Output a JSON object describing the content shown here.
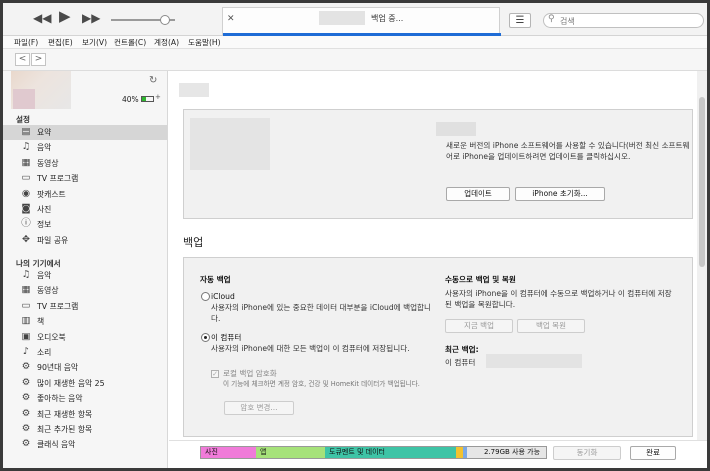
{
  "player": {
    "prev_icon": "rewind-icon",
    "play_icon": "play-icon",
    "next_icon": "fast-forward-icon",
    "volume_level": 0.85
  },
  "lcd": {
    "status": "백업 중...",
    "close_icon": "close-icon"
  },
  "search": {
    "placeholder": "검색"
  },
  "menu": [
    "파일(F)",
    "편집(E)",
    "보기(V)",
    "컨트롤(C)",
    "계정(A)",
    "도움말(H)"
  ],
  "nav": {
    "back": "<",
    "forward": ">"
  },
  "device": {
    "battery": "40%",
    "battery_level": 0.4
  },
  "sidebar": {
    "settings_title": "설정",
    "settings_items": [
      {
        "label": "요약",
        "icon": "summary-icon",
        "glyph": "▤",
        "selected": true
      },
      {
        "label": "음악",
        "icon": "music-note-icon",
        "glyph": "♫"
      },
      {
        "label": "동영상",
        "icon": "film-icon",
        "glyph": "▦"
      },
      {
        "label": "TV 프로그램",
        "icon": "tv-icon",
        "glyph": "▭"
      },
      {
        "label": "팟캐스트",
        "icon": "podcast-icon",
        "glyph": "◉"
      },
      {
        "label": "사진",
        "icon": "camera-icon",
        "glyph": "◙"
      },
      {
        "label": "정보",
        "icon": "info-icon",
        "glyph": "ⓘ"
      },
      {
        "label": "파일 공유",
        "icon": "file-sharing-icon",
        "glyph": "✥"
      }
    ],
    "device_title": "나의 기기에서",
    "device_items": [
      {
        "label": "음악",
        "icon": "music-note-icon",
        "glyph": "♫"
      },
      {
        "label": "동영상",
        "icon": "film-icon",
        "glyph": "▦"
      },
      {
        "label": "TV 프로그램",
        "icon": "tv-icon",
        "glyph": "▭"
      },
      {
        "label": "책",
        "icon": "book-icon",
        "glyph": "▥"
      },
      {
        "label": "오디오북",
        "icon": "audiobook-icon",
        "glyph": "▣"
      },
      {
        "label": "소리",
        "icon": "bell-icon",
        "glyph": "♪"
      },
      {
        "label": "90년대 음악",
        "icon": "smart-playlist-gear-icon",
        "glyph": "⚙"
      },
      {
        "label": "많이 재생한 음악 25",
        "icon": "smart-playlist-gear-icon",
        "glyph": "⚙"
      },
      {
        "label": "좋아하는 음악",
        "icon": "smart-playlist-gear-icon",
        "glyph": "⚙"
      },
      {
        "label": "최근 재생한 항목",
        "icon": "smart-playlist-gear-icon",
        "glyph": "⚙"
      },
      {
        "label": "최근 추가된 항목",
        "icon": "smart-playlist-gear-icon",
        "glyph": "⚙"
      },
      {
        "label": "클래식 음악",
        "icon": "smart-playlist-gear-icon",
        "glyph": "⚙"
      }
    ]
  },
  "software": {
    "message": "새로운 버전의 iPhone 소프트웨어를 사용할 수 있습니다(버전 최신 소프트웨어로 iPhone을 업데이트하려면 업데이트를 클릭하십시오.",
    "update_button": "업데이트",
    "restore_button": "iPhone 초기화..."
  },
  "backup": {
    "heading": "백업",
    "auto_title": "자동 백업",
    "icloud_label": "iCloud",
    "icloud_desc": "사용자의 iPhone에 있는 중요한 데이터 대부분을 iCloud에 백업합니다.",
    "computer_label": "이 컴퓨터",
    "computer_desc": "사용자의 iPhone에 대한 모든 백업이 이 컴퓨터에 저장됩니다.",
    "encrypt_label": "로컬 백업 암호화",
    "encrypt_desc": "이 기능에 체크하면 계정 암호, 건강 및 HomeKit 데이터가 백업됩니다.",
    "change_password_button": "암호 변경...",
    "manual_title": "수동으로 백업 및 복원",
    "manual_desc": "사용자의 iPhone을 이 컴퓨터에 수동으로 백업하거나 이 컴퓨터에 저장된 백업을 복원합니다.",
    "backup_now_button": "지금 백업",
    "restore_backup_button": "백업 복원",
    "latest_title": "최근 백업:",
    "latest_value": "이 컴퓨터"
  },
  "storage": {
    "segments": [
      {
        "label": "사진",
        "color": "#f07bd9",
        "fraction": 0.16
      },
      {
        "label": "앱",
        "color": "#a6e27a",
        "fraction": 0.2
      },
      {
        "label": "도큐멘트 및 데이터",
        "color": "#3ec4a6",
        "fraction": 0.38
      },
      {
        "label": "",
        "color": "#f2c230",
        "fraction": 0.02
      },
      {
        "label": "",
        "color": "#7aa9e6",
        "fraction": 0.01
      }
    ],
    "free_label": "2.79GB 사용 가능"
  },
  "footer": {
    "sync_button": "동기화",
    "done_button": "완료"
  }
}
